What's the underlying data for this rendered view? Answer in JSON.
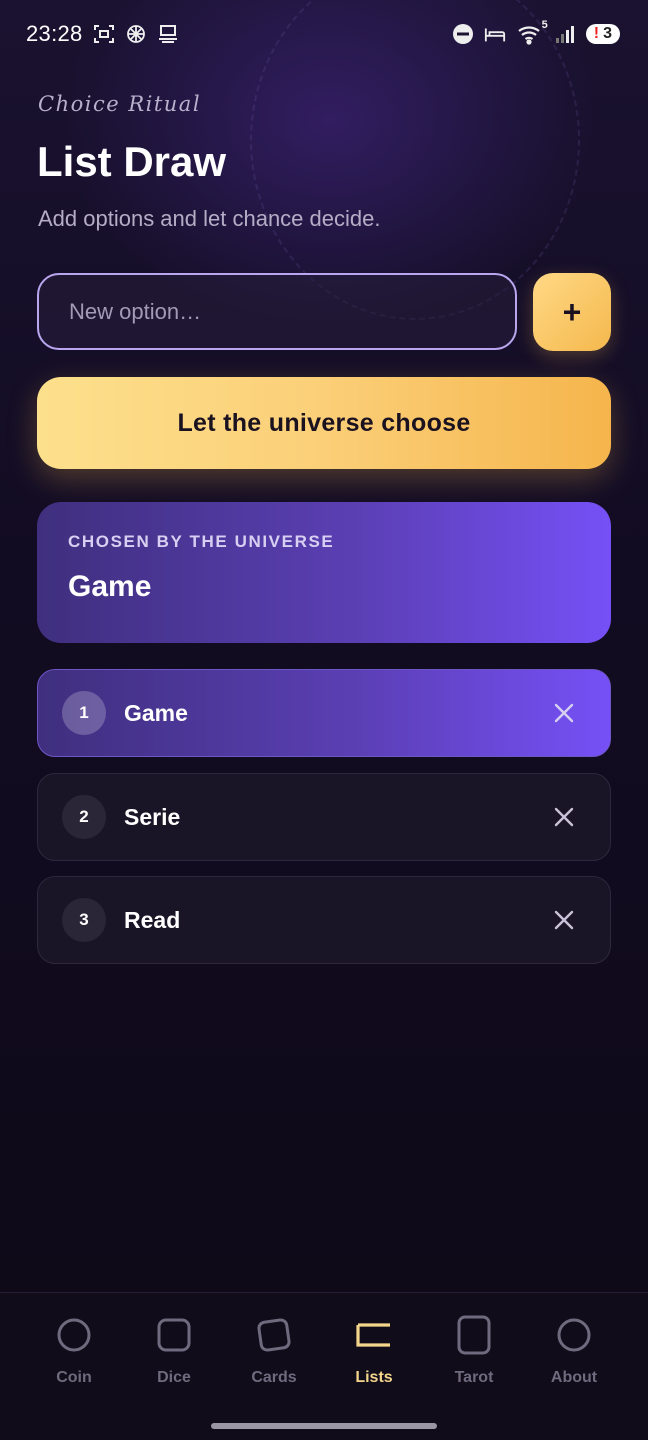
{
  "status_bar": {
    "time": "23:28",
    "notification_count": "3",
    "notification_mark": "!",
    "wifi_badge": "5"
  },
  "header": {
    "eyebrow": "Choice Ritual",
    "title": "List Draw",
    "subtitle": "Add options and let chance decide."
  },
  "input": {
    "placeholder": "New option…",
    "value": "",
    "add_label": "+"
  },
  "choose_button": {
    "label": "Let the universe choose"
  },
  "result": {
    "label": "CHOSEN BY THE UNIVERSE",
    "value": "Game"
  },
  "options": [
    {
      "num": "1",
      "label": "Game",
      "selected": true
    },
    {
      "num": "2",
      "label": "Serie",
      "selected": false
    },
    {
      "num": "3",
      "label": "Read",
      "selected": false
    }
  ],
  "nav": {
    "items": [
      {
        "label": "Coin",
        "icon": "circle-icon",
        "active": false
      },
      {
        "label": "Dice",
        "icon": "rounded-square-icon",
        "active": false
      },
      {
        "label": "Cards",
        "icon": "tilted-card-icon",
        "active": false
      },
      {
        "label": "Lists",
        "icon": "list-bracket-icon",
        "active": true
      },
      {
        "label": "Tarot",
        "icon": "tall-card-icon",
        "active": false
      },
      {
        "label": "About",
        "icon": "circle-icon",
        "active": false
      }
    ]
  },
  "colors": {
    "accent_gold": "#f5b84d",
    "accent_purple": "#7650f6",
    "background": "#0e0a18"
  }
}
